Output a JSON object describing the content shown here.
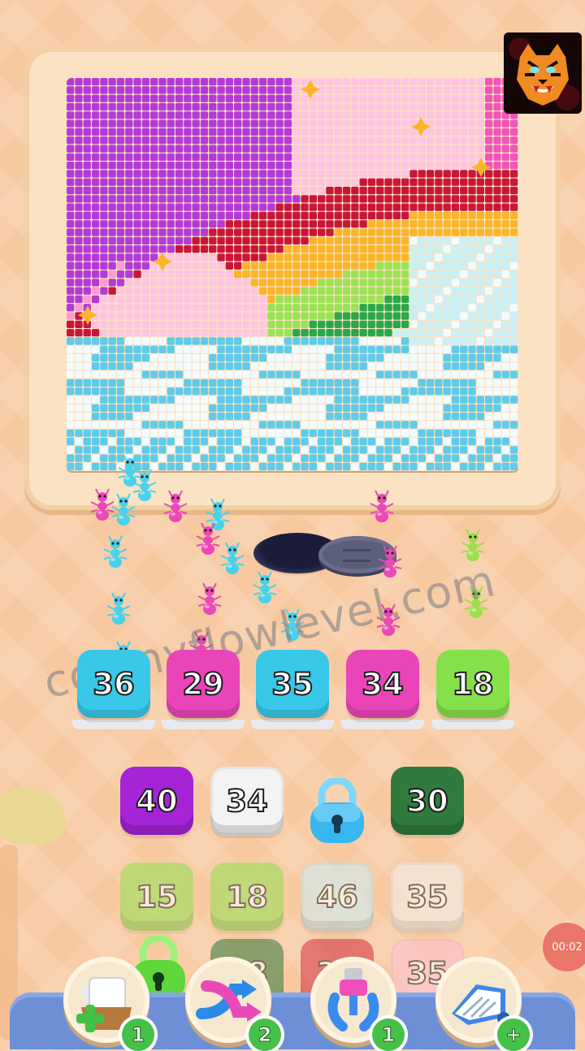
{
  "game": {
    "slot_tiles": [
      {
        "value": "36",
        "color": "#39c8e8"
      },
      {
        "value": "29",
        "color": "#ea45b8"
      },
      {
        "value": "35",
        "color": "#39c8e8"
      },
      {
        "value": "34",
        "color": "#ea45b8"
      },
      {
        "value": "18",
        "color": "#86e04a"
      }
    ],
    "grid_tiles": [
      {
        "value": "40",
        "color": "#a424d6"
      },
      {
        "value": "34",
        "color": "#f3f3f3"
      },
      {
        "value": "",
        "color": "#3ab9f0",
        "locked": true
      },
      {
        "value": "30",
        "color": "#2f7a3c"
      },
      {
        "value": "15",
        "color": "#92e04f"
      },
      {
        "value": "18",
        "color": "#92e04f"
      },
      {
        "value": "46",
        "color": "#c9eef5"
      },
      {
        "value": "35",
        "color": "#f3f3f3"
      },
      {
        "value": "",
        "color": "#6fdc3a",
        "locked": true
      },
      {
        "value": "28",
        "color": "#2f7a3c"
      },
      {
        "value": "30",
        "color": "#d43040"
      },
      {
        "value": "35",
        "color": "#ffc2d8"
      }
    ],
    "tools": [
      {
        "icon": "add-card-icon",
        "count": "1"
      },
      {
        "icon": "shuffle-arrows-icon",
        "count": "2"
      },
      {
        "icon": "magnet-claw-icon",
        "count": "1"
      },
      {
        "icon": "vacuum-icon",
        "count": "+"
      }
    ],
    "timer": "00:02",
    "watermark": "colonyflowlevel.com"
  },
  "palette": {
    "cyan": "#39c8e8",
    "pink": "#ea45b8",
    "lime": "#86e04a",
    "board_magenta": "#b43ad8"
  }
}
